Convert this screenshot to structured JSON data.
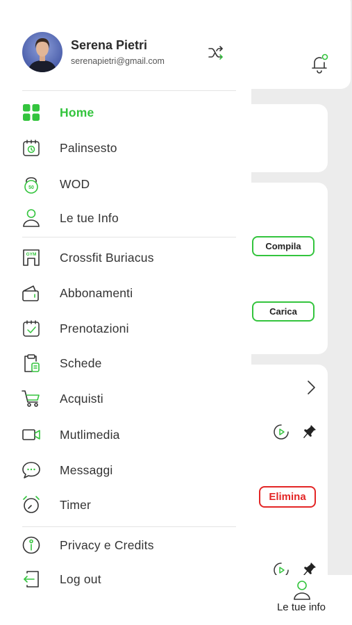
{
  "colors": {
    "accent": "#33c43d",
    "danger": "#e32525",
    "text": "#333333",
    "background": "#ececec"
  },
  "user": {
    "name": "Serena Pietri",
    "email": "serenapietri@gmail.com"
  },
  "menu": {
    "items": [
      {
        "label": "Home",
        "icon": "grid-icon",
        "active": true
      },
      {
        "label": "Palinsesto",
        "icon": "calendar-schedule-icon"
      },
      {
        "label": "WOD",
        "icon": "kettlebell-icon"
      },
      {
        "label": "Le tue Info",
        "icon": "user-icon"
      },
      {
        "label": "Crossfit Buriacus",
        "icon": "gym-icon"
      },
      {
        "label": "Abbonamenti",
        "icon": "wallet-icon"
      },
      {
        "label": "Prenotazioni",
        "icon": "calendar-check-icon"
      },
      {
        "label": "Schede",
        "icon": "clipboard-icon"
      },
      {
        "label": "Acquisti",
        "icon": "cart-icon"
      },
      {
        "label": "Mutlimedia",
        "icon": "video-icon"
      },
      {
        "label": "Messaggi",
        "icon": "chat-icon"
      },
      {
        "label": "Timer",
        "icon": "timer-icon"
      },
      {
        "label": "Privacy e Credits",
        "icon": "info-icon"
      },
      {
        "label": "Log out",
        "icon": "logout-icon"
      }
    ]
  },
  "background_app": {
    "buttons": {
      "compila": "Compila",
      "carica": "Carica",
      "elimina": "Elimina"
    },
    "bottom_nav": {
      "label": "Le tue info"
    }
  }
}
